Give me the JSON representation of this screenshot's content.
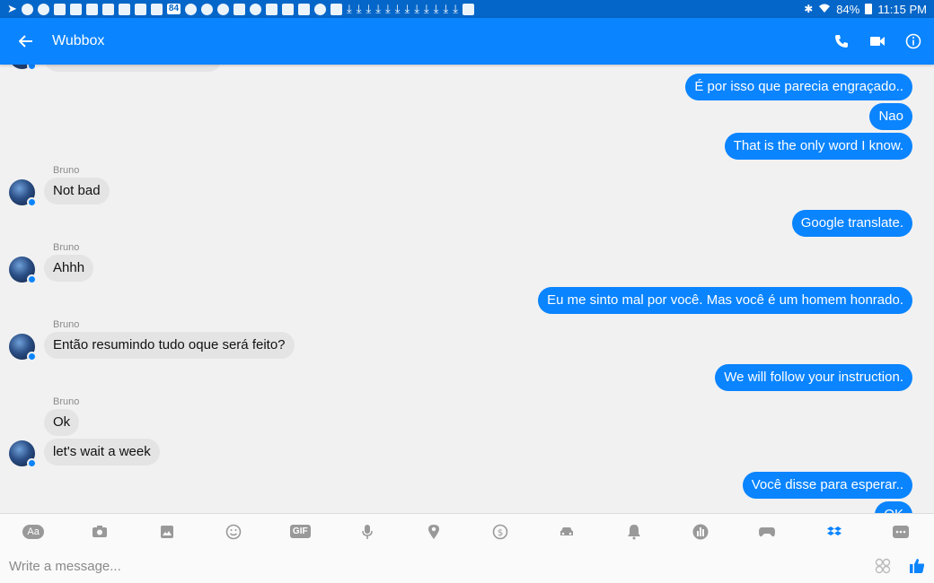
{
  "statusbar": {
    "notif_badge": "84",
    "battery": "84%",
    "time": "11:15 PM"
  },
  "header": {
    "title": "Wubbox",
    "back_icon": "arrow-left-icon",
    "actions": [
      "phone-icon",
      "video-camera-icon",
      "info-icon"
    ]
  },
  "conversation": {
    "messages": [
      {
        "dir": "out",
        "text": "É por isso que parecia engraçado.."
      },
      {
        "dir": "out",
        "text": "Nao"
      },
      {
        "dir": "out",
        "text": "That is the only word I know."
      },
      {
        "dir": "in",
        "sender": "Bruno",
        "text": "Not bad"
      },
      {
        "dir": "out",
        "text": "Google translate."
      },
      {
        "dir": "in",
        "sender": "Bruno",
        "text": "Ahhh"
      },
      {
        "dir": "out",
        "text": "Eu me sinto mal por você. Mas você é um homem honrado."
      },
      {
        "dir": "in",
        "sender": "Bruno",
        "text": "Então resumindo tudo oque será feito?"
      },
      {
        "dir": "out",
        "text": "We will follow your instruction."
      },
      {
        "dir": "in",
        "sender": "Bruno",
        "text": "Ok"
      },
      {
        "dir": "in",
        "text": "let's wait a week"
      },
      {
        "dir": "out",
        "text": "Você disse para esperar.."
      },
      {
        "dir": "out",
        "text": "OK"
      }
    ]
  },
  "toolbar": {
    "text_label": "Aa",
    "gif_label": "GIF",
    "tools": [
      "text-format-icon",
      "camera-icon",
      "gallery-icon",
      "emoji-icon",
      "gif-icon",
      "microphone-icon",
      "location-icon",
      "payment-icon",
      "car-icon",
      "bell-icon",
      "poll-icon",
      "game-controller-icon",
      "dropbox-icon",
      "more-icon"
    ]
  },
  "composer": {
    "placeholder": "Write a message...",
    "accent": "#0a84ff"
  }
}
